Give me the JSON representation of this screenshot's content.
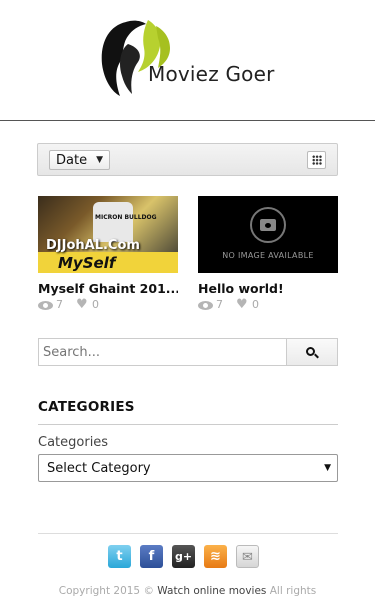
{
  "header": {
    "logo_text": "Moviez Goer"
  },
  "filter": {
    "sort_value": "Date",
    "grid_icon": "grid-icon"
  },
  "posts": [
    {
      "title": "Myself Ghaint 201...",
      "thumb_watermark": "DJJohAL.Com",
      "thumb_shirt_text": "MICRON BULLDOG",
      "thumb_big_text": "MySelf",
      "views": "7",
      "likes": "0"
    },
    {
      "title": "Hello world!",
      "thumb_text": "NO IMAGE AVAILABLE",
      "views": "7",
      "likes": "0"
    }
  ],
  "search": {
    "placeholder": "Search..."
  },
  "categories": {
    "heading": "CATEGORIES",
    "label": "Categories",
    "selected": "Select Category"
  },
  "footer": {
    "social_icons": [
      "twitter-icon",
      "facebook-icon",
      "google-plus-icon",
      "rss-icon",
      "email-icon"
    ],
    "copyright_prefix": "Copyright 2015 ©",
    "copyright_link": "Watch online movies",
    "copyright_suffix": "All rights"
  },
  "colors": {
    "twitter": "#2aa7d8",
    "facebook": "#2d4f98",
    "rss": "#e77a14",
    "logo_accent": "#b7d12f"
  }
}
